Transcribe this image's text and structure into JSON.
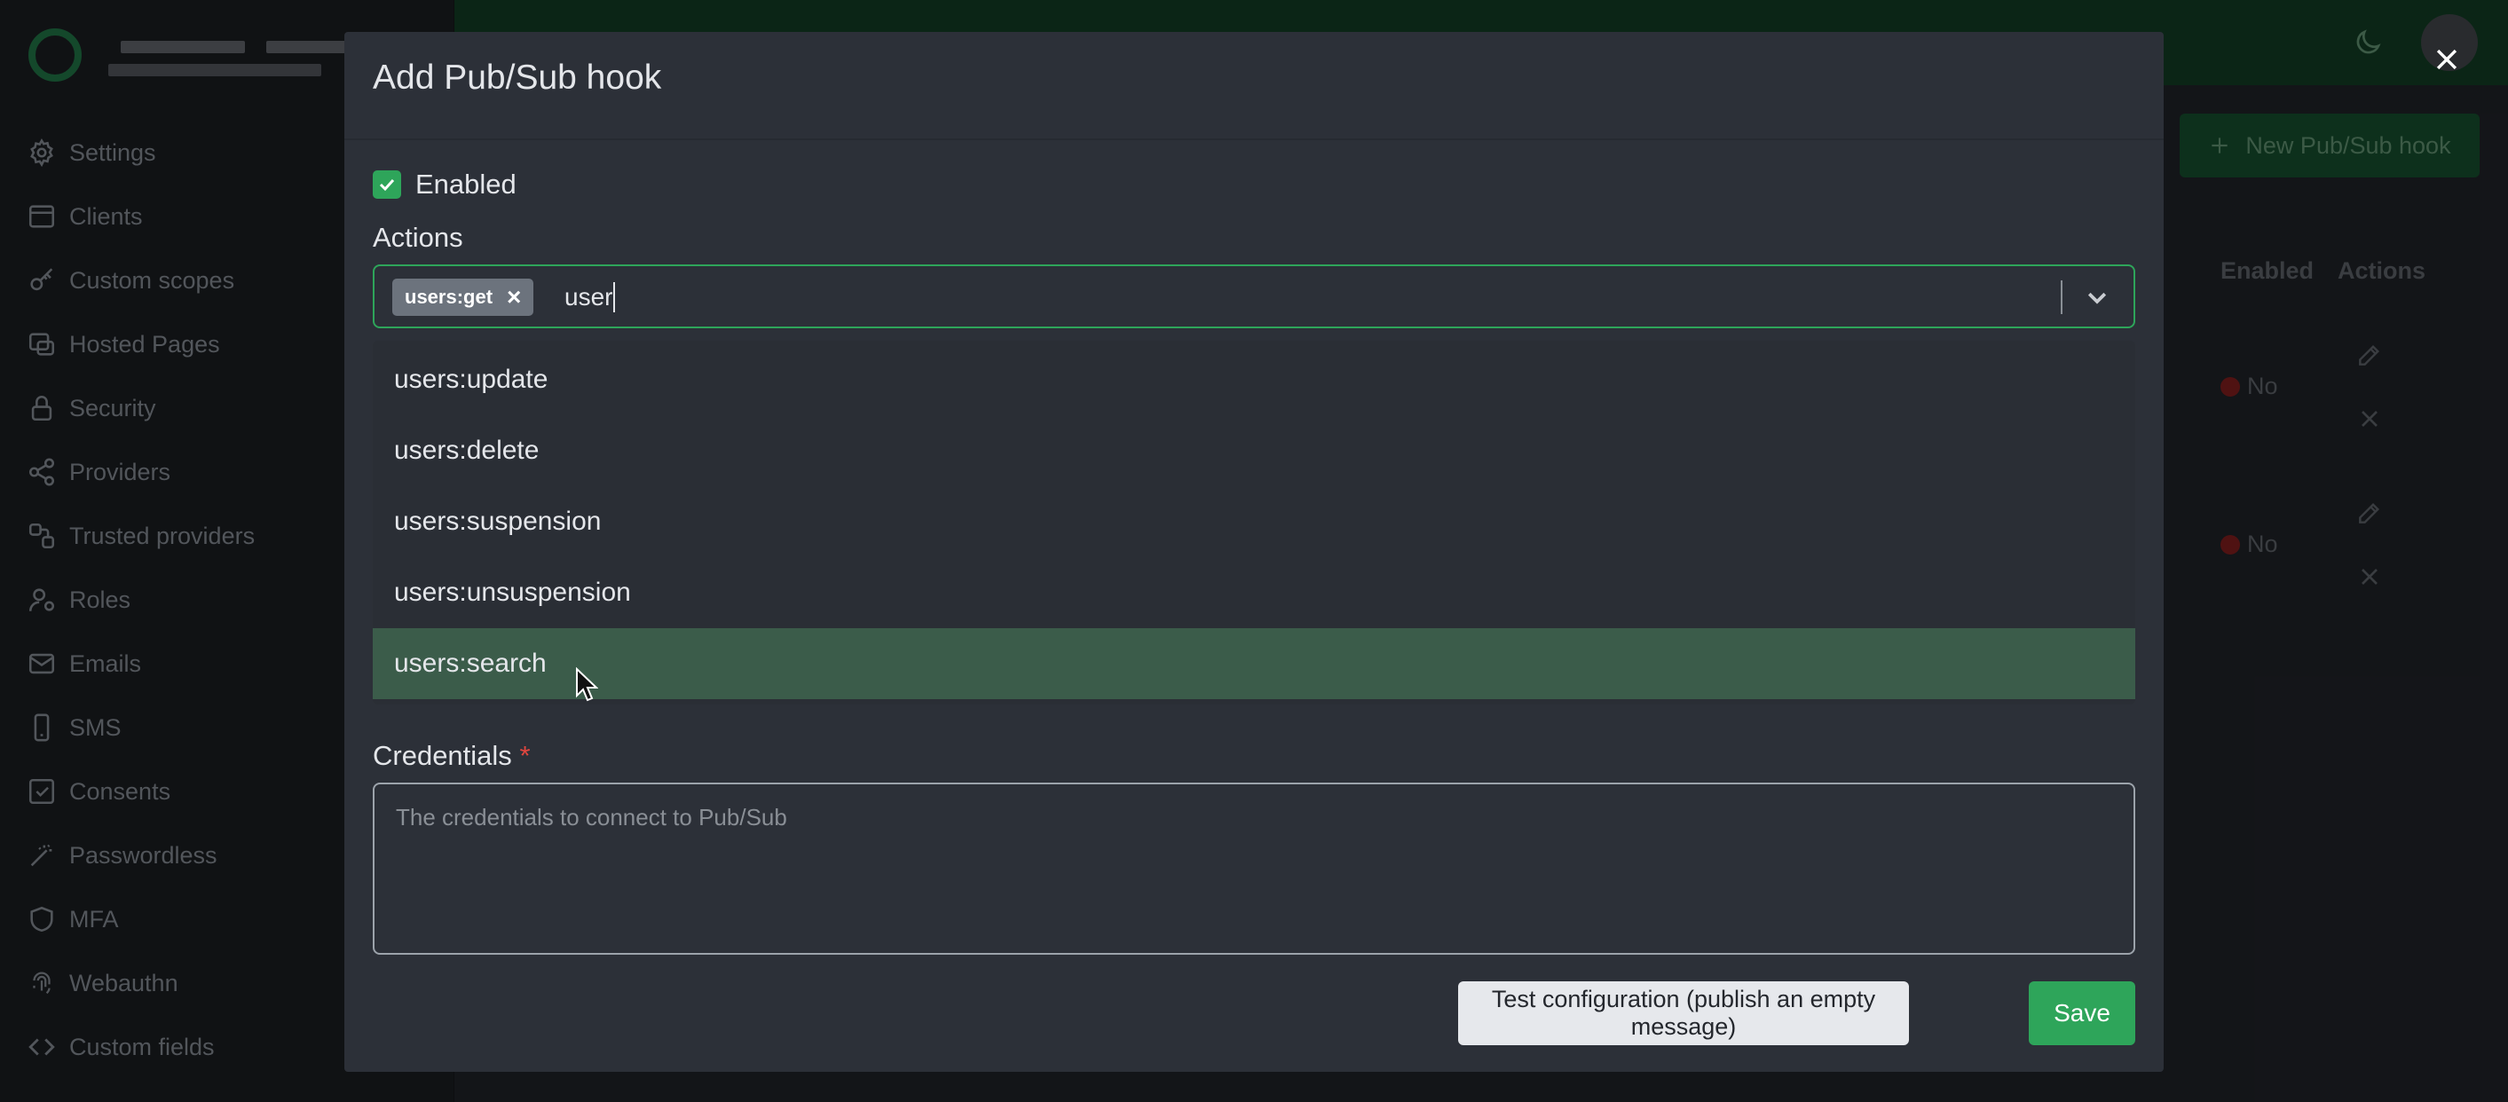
{
  "sidebar": {
    "items": [
      {
        "label": "Settings",
        "icon": "gear-icon"
      },
      {
        "label": "Clients",
        "icon": "window-icon"
      },
      {
        "label": "Custom scopes",
        "icon": "key-icon"
      },
      {
        "label": "Hosted Pages",
        "icon": "pages-icon"
      },
      {
        "label": "Security",
        "icon": "lock-icon"
      },
      {
        "label": "Providers",
        "icon": "share-icon"
      },
      {
        "label": "Trusted providers",
        "icon": "link-icon"
      },
      {
        "label": "Roles",
        "icon": "user-gear-icon"
      },
      {
        "label": "Emails",
        "icon": "mail-icon"
      },
      {
        "label": "SMS",
        "icon": "phone-icon"
      },
      {
        "label": "Consents",
        "icon": "check-square-icon"
      },
      {
        "label": "Passwordless",
        "icon": "wand-icon"
      },
      {
        "label": "MFA",
        "icon": "shield-icon"
      },
      {
        "label": "Webauthn",
        "icon": "fingerprint-icon"
      },
      {
        "label": "Custom fields",
        "icon": "code-icon"
      }
    ]
  },
  "background": {
    "new_button_label": "New Pub/Sub hook",
    "columns": [
      "Enabled",
      "Actions"
    ],
    "rows": [
      {
        "enabled": "No"
      },
      {
        "enabled": "No"
      }
    ]
  },
  "modal": {
    "title": "Add Pub/Sub hook",
    "enabled_label": "Enabled",
    "enabled_checked": true,
    "actions_label": "Actions",
    "selected_tags": [
      "users:get"
    ],
    "search_value": "user",
    "options": [
      "users:update",
      "users:delete",
      "users:suspension",
      "users:unsuspension",
      "users:search"
    ],
    "highlighted_option": "users:search",
    "credentials_label": "Credentials",
    "credentials_required_mark": "*",
    "credentials_placeholder": "The credentials to connect to Pub/Sub",
    "test_button_label": "Test configuration (publish an empty message)",
    "save_button_label": "Save"
  },
  "colors": {
    "accent": "#2ea55a",
    "topbar": "#113a22",
    "highlight": "#3b5c4a",
    "required": "#e0463f",
    "status_no": "#7a1d1d"
  }
}
